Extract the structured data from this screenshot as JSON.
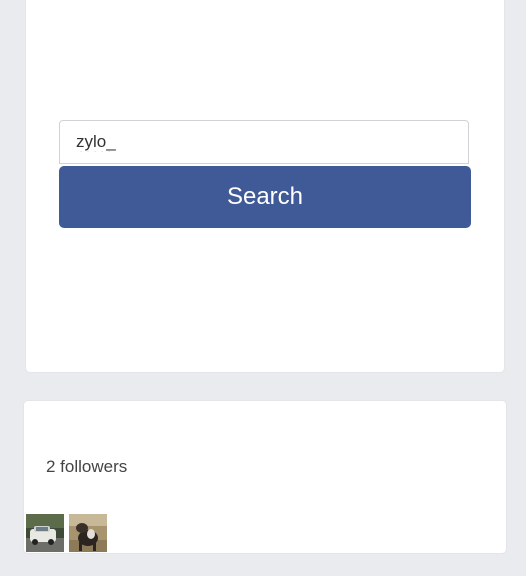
{
  "search": {
    "input_value": "zylo_",
    "button_label": "Search"
  },
  "followers": {
    "count_label": "2 followers",
    "avatars": [
      {
        "name": "follower-avatar-1",
        "kind": "photo of a white car"
      },
      {
        "name": "follower-avatar-2",
        "kind": "photo of a dog"
      }
    ]
  },
  "colors": {
    "page_background": "#e9ebee",
    "card_background": "#ffffff",
    "button_background": "#3f5a96",
    "button_text": "#ffffff",
    "spellcheck_underline": "#d93b2e"
  }
}
